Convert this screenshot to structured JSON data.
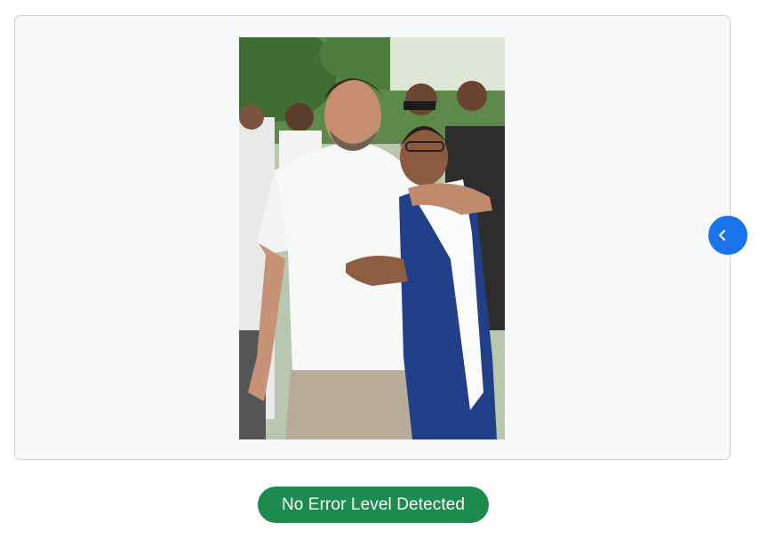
{
  "image_viewer": {
    "photo_description_alt": "Photo of a smiling man in a white polo shirt hugging a woman in a blue dress and white scarf, with people standing behind them outdoors",
    "toggle_icon": "chevron-left-icon",
    "accent_color": "#1a73e8"
  },
  "analysis": {
    "status_label": "No Error Level Detected",
    "status_color": "#1d8a4e"
  }
}
